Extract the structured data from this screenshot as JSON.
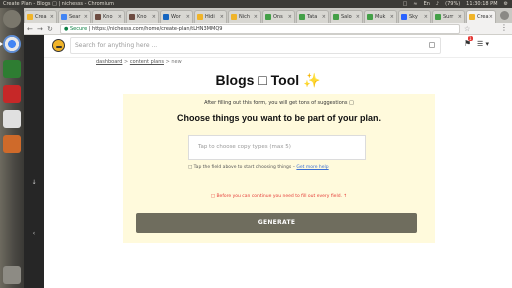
{
  "os_panel": {
    "window_title": "Create Plan - Blogs □ | nichesss - Chromium",
    "battery": "(79%)",
    "clock": "11:30:18 PM"
  },
  "browser": {
    "tabs": [
      {
        "label": "Crea"
      },
      {
        "label": "Sear"
      },
      {
        "label": "Kno"
      },
      {
        "label": "Kno"
      },
      {
        "label": "Wor"
      },
      {
        "label": "Hidi"
      },
      {
        "label": "Nich"
      },
      {
        "label": "Ons"
      },
      {
        "label": "Tata"
      },
      {
        "label": "Salo"
      },
      {
        "label": "Muk"
      },
      {
        "label": "Sky"
      },
      {
        "label": "Surr"
      },
      {
        "label": "Crea"
      }
    ],
    "address": {
      "secure_label": "Secure",
      "url": "https://nichesss.com/home/create-plan/tLHN3MMQ9"
    }
  },
  "site": {
    "search_placeholder": "Search for anything here ...",
    "notification_count": "1",
    "breadcrumb": {
      "dashboard": "dashboard",
      "content_plans": "content plans",
      "current": "new",
      "separator": ">"
    },
    "title": "Blogs □ Tool ✨",
    "form": {
      "info_text": "After filling out this form, you will get tons of suggestions □",
      "heading": "Choose things you want to be part of your plan.",
      "input_placeholder": "Tap to choose copy types (max 5)",
      "hint_text": "□ Tap the field above to start choosing things –",
      "hint_link": "Get more help",
      "warning": "□ Before you can continue you need to fill out every field. ↑",
      "generate_label": "GENERATE"
    }
  },
  "colors": {
    "card_background": "#fffadc",
    "generate_button": "#6f6d5e",
    "warning_text": "#e53935",
    "link": "#3b6fd4"
  }
}
